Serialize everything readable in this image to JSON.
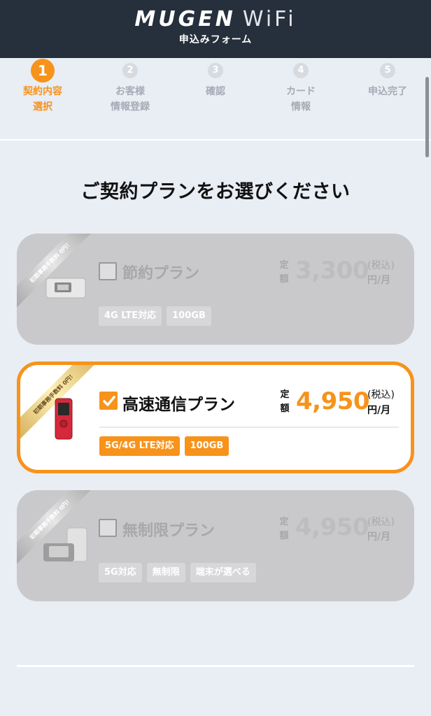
{
  "header": {
    "logo_main": "MUGEN",
    "logo_sub": "WiFi",
    "subtitle": "申込みフォーム"
  },
  "steps": [
    {
      "num": "1",
      "label": "契約内容\n選択",
      "active": true
    },
    {
      "num": "2",
      "label": "お客様\n情報登録",
      "active": false
    },
    {
      "num": "3",
      "label": "確認",
      "active": false
    },
    {
      "num": "4",
      "label": "カード\n情報",
      "active": false
    },
    {
      "num": "5",
      "label": "申込完了",
      "active": false
    }
  ],
  "heading": "ご契約プランをお選びください",
  "plans": [
    {
      "ribbon": "初期事務手数料 0円！",
      "name": "節約プラン",
      "price_label": "定額",
      "price": "3,300",
      "tax": "(税込)",
      "unit": "円/月",
      "tags": [
        "4G LTE対応",
        "100GB"
      ],
      "selected": false
    },
    {
      "ribbon": "初期事務手数料 0円！",
      "name": "高速通信プラン",
      "price_label": "定額",
      "price": "4,950",
      "tax": "(税込)",
      "unit": "円/月",
      "tags": [
        "5G/4G LTE対応",
        "100GB"
      ],
      "selected": true
    },
    {
      "ribbon": "初期事務手数料 0円！",
      "name": "無制限プラン",
      "price_label": "定額",
      "price": "4,950",
      "tax": "(税込)",
      "unit": "円/月",
      "tags": [
        "5G対応",
        "無制限",
        "端末が選べる"
      ],
      "selected": false
    }
  ],
  "colors": {
    "accent": "#f7931a",
    "header_bg": "#262f3c",
    "page_bg": "#e9edf4",
    "disabled_card": "#c9c9cb"
  }
}
